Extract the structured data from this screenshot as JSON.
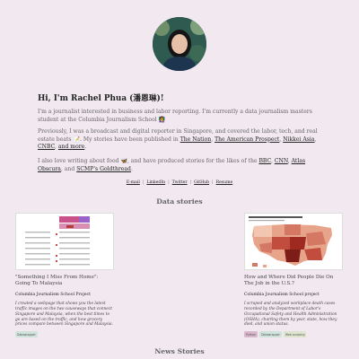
{
  "profile": {
    "avatar_alt": "portrait photo",
    "greeting": "Hi, I'm Rachel Phua (潘恩琳)!"
  },
  "intro": {
    "p1_text": "I'm a journalist interested in business and labor reporting. I'm currently a data journalism masters student at the Columbia Journalism School",
    "p1_emoji": "👩‍🏫",
    "p2_text1": "Previously, I was a broadcast and digital reporter in Singapore, and covered the labor, tech, and real estate beats",
    "p2_emoji": "📝",
    "p2_text2": ". My stories have been published in",
    "outlets": [
      "The Nation",
      "The American Prospect",
      "Nikkei Asia",
      "CNBC",
      "and more"
    ],
    "p3_text1": "I also love writing about food",
    "p3_emoji": "🦋",
    "p3_text2": ", and have produced stories for the likes of the",
    "food_outlets": [
      "BBC",
      "CNN",
      "Atlas Obscura",
      "SCMP's Goldthread"
    ]
  },
  "social_links": [
    "E-mail",
    "LinkedIn",
    "Twitter",
    "GitHub",
    "Resume"
  ],
  "data_stories": {
    "title": "Data stories",
    "cards": [
      {
        "title": "\"Something I Miss From Home\": Going To Malaysia",
        "subtitle": "Columbia Journalism School Project",
        "description": "I created a webpage that shows you the latest traffic images on the two causeways that connect Singapore and Malaysia, when the best times to go are based on the traffic, and how grocery prices compare between Singapore and Malaysia.",
        "tags": [
          {
            "label": "Datawrapper",
            "color": "#cfe3dc"
          }
        ]
      },
      {
        "title": "How and Where Did People Die On The Job in the U.S.?",
        "subtitle": "Columbia Journalism School project",
        "description": "I scraped and analyzed workplace death cases recorded by the Department of Labor's Occupational Safety and Health Administration (OSHA), charting them by year, state, how they died, and union status.",
        "tags": [
          {
            "label": "Python",
            "color": "#d9b8cf"
          },
          {
            "label": "Datawrapper",
            "color": "#cfe3dc"
          },
          {
            "label": "Web scraping",
            "color": "#dde5cf"
          }
        ]
      }
    ]
  },
  "news_stories": {
    "title": "News Stories"
  }
}
